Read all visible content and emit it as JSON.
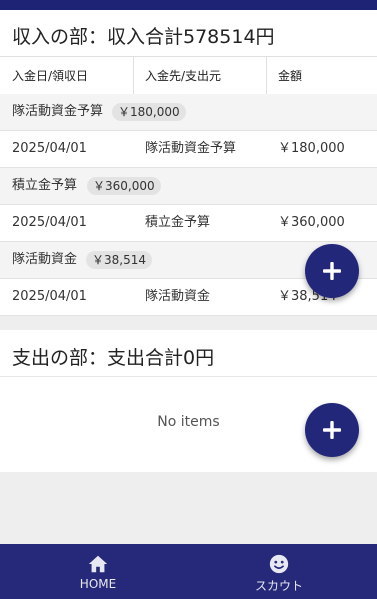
{
  "income": {
    "title": "収入の部：収入合計578514円",
    "columns": [
      "入金日/領収日",
      "入金先/支出元",
      "金額"
    ],
    "groups": [
      {
        "name": "隊活動資金予算",
        "total": "￥180,000",
        "row": {
          "date": "2025/04/01",
          "source": "隊活動資金予算",
          "amount": "￥180,000"
        }
      },
      {
        "name": "積立金予算",
        "total": "￥360,000",
        "row": {
          "date": "2025/04/01",
          "source": "積立金予算",
          "amount": "￥360,000"
        }
      },
      {
        "name": "隊活動資金",
        "total": "￥38,514",
        "row": {
          "date": "2025/04/01",
          "source": "隊活動資金",
          "amount": "￥38,514"
        }
      }
    ]
  },
  "expense": {
    "title": "支出の部：支出合計0円",
    "empty_text": "No items"
  },
  "fab": {
    "icon": "plus-icon"
  },
  "nav": {
    "items": [
      {
        "label": "HOME",
        "icon": "home-icon"
      },
      {
        "label": "スカウト",
        "icon": "smiley-icon"
      }
    ]
  },
  "colors": {
    "primary": "#23277a",
    "nav_bg": "#26297a",
    "group_bg": "#f4f4f4"
  }
}
